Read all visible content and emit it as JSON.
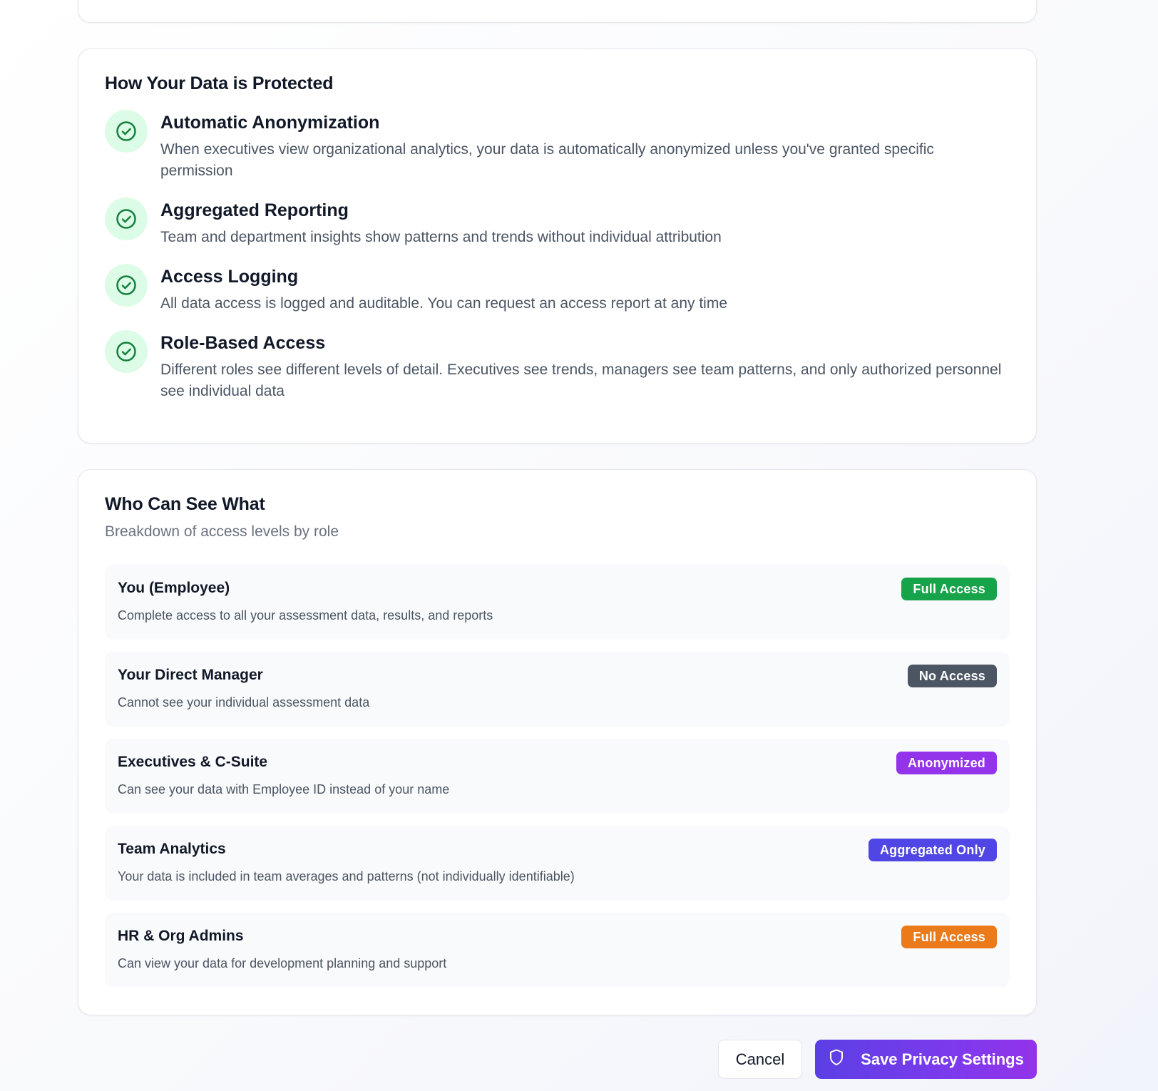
{
  "protection": {
    "title": "How Your Data is Protected",
    "features": [
      {
        "icon": "check-circle-icon",
        "title": "Automatic Anonymization",
        "description": "When executives view organizational analytics, your data is automatically anonymized unless you've granted specific permission"
      },
      {
        "icon": "check-circle-icon",
        "title": "Aggregated Reporting",
        "description": "Team and department insights show patterns and trends without individual attribution"
      },
      {
        "icon": "check-circle-icon",
        "title": "Access Logging",
        "description": "All data access is logged and auditable. You can request an access report at any time"
      },
      {
        "icon": "check-circle-icon",
        "title": "Role-Based Access",
        "description": "Different roles see different levels of detail. Executives see trends, managers see team patterns, and only authorized personnel see individual data"
      }
    ]
  },
  "access": {
    "title": "Who Can See What",
    "subtitle": "Breakdown of access levels by role",
    "roles": [
      {
        "title": "You (Employee)",
        "description": "Complete access to all your assessment data, results, and reports",
        "badge": "Full Access",
        "badge_color": "#16a34a"
      },
      {
        "title": "Your Direct Manager",
        "description": "Cannot see your individual assessment data",
        "badge": "No Access",
        "badge_color": "#4b5563"
      },
      {
        "title": "Executives & C-Suite",
        "description": "Can see your data with Employee ID instead of your name",
        "badge": "Anonymized",
        "badge_color": "#9333ea"
      },
      {
        "title": "Team Analytics",
        "description": "Your data is included in team averages and patterns (not individually identifiable)",
        "badge": "Aggregated Only",
        "badge_color": "#4f46e5"
      },
      {
        "title": "HR & Org Admins",
        "description": "Can view your data for development planning and support",
        "badge": "Full Access",
        "badge_color": "#ea7a1a"
      }
    ]
  },
  "actions": {
    "cancel_label": "Cancel",
    "save_label": "Save Privacy Settings",
    "save_icon": "shield-icon"
  },
  "colors": {
    "success_icon_bg": "#dcfce7",
    "success_icon_fg": "#16a34a",
    "primary": "#6d3ef0"
  }
}
